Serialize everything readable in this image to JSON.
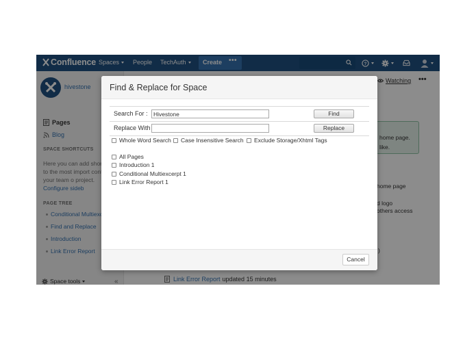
{
  "topnav": {
    "logo": "Confluence",
    "spaces": "Spaces",
    "people": "People",
    "techauth": "TechAuth",
    "create": "Create",
    "more": "•••",
    "icons": [
      "search-icon",
      "help-icon",
      "gear-icon",
      "notifications-icon",
      "user-avatar-icon"
    ]
  },
  "sidebar": {
    "space_name": "hivestone",
    "links": {
      "pages": "Pages",
      "blog": "Blog"
    },
    "shortcuts_heading": "SPACE SHORTCUTS",
    "shortcuts_text": "Here you can add short links to the most import content for your team o project.",
    "shortcuts_link": "Configure sideb",
    "tree_heading": "PAGE TREE",
    "tree": [
      "Conditional Multiexc",
      "Find and Replace",
      "Introduction",
      "Link Error Report"
    ],
    "space_tools": "Space tools"
  },
  "main": {
    "watching": "Watching",
    "more": "•••",
    "info": [
      "home page.",
      "like."
    ],
    "text_lines": [
      "home page",
      "d logo",
      "others access",
      ")"
    ],
    "recent_link": "Link Error Report",
    "recent_rest": "updated 15 minutes"
  },
  "dialog": {
    "title": "Find & Replace for Space",
    "search_label": "Search For :",
    "search_value": "Hivestone",
    "replace_label": "Replace With :",
    "replace_value": "",
    "find_button": "Find",
    "replace_button": "Replace",
    "options": [
      "Whole Word Search",
      "Case Insensitive Search",
      "Exclude Storage/Xhtml Tags"
    ],
    "pages": [
      "All Pages",
      "Introduction 1",
      "Conditional Multiexcerpt 1",
      "Link Error Report 1"
    ],
    "cancel_button": "Cancel"
  },
  "colors": {
    "header": "#205081",
    "create_button": "#3572b0",
    "link": "#3572b0",
    "overlay": "#000000"
  }
}
